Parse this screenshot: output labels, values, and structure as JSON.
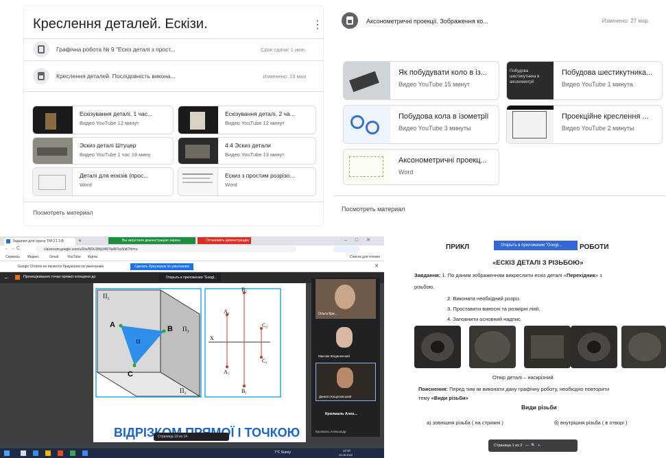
{
  "q1": {
    "title": "Креслення деталей. Ескізи.",
    "row1": {
      "title": "Графічна робота № 9 \"Ескіз деталі з прост...",
      "due": "Срок сдачи: 1 июн."
    },
    "row2": {
      "title": "Креслення деталей. Послідовність викона...",
      "changed": "Изменено: 23 мая"
    },
    "cards": [
      {
        "title": "Ескізування деталі, 1 час...",
        "meta": "Видео YouTube   12 минут"
      },
      {
        "title": "Ескізування деталі, 2 ча...",
        "meta": "Видео YouTube   12 минут"
      },
      {
        "title": "Эскиз деталі Штуцер",
        "meta": "Видео YouTube   1 час 19 мину"
      },
      {
        "title": "4 4 Эскиз детали",
        "meta": "Видео YouTube   13 минут"
      },
      {
        "title": "Деталі для ескізів (прос...",
        "meta": "Word"
      },
      {
        "title": "Ескиз з простим розрізо...",
        "meta": "Word"
      }
    ],
    "view": "Посмотреть материал"
  },
  "q2": {
    "title": "Аксонометричні проекції. Зображення ко...",
    "changed": "Изменено: 27 мар.",
    "cards": [
      {
        "title": "Як побудувати коло в із...",
        "meta": "Видео YouTube   15 минут"
      },
      {
        "title": "Побудова шестикутника...",
        "meta": "Видео YouTube   1 минута",
        "thumb": "Побудова шестикутника в аксонометрії"
      },
      {
        "title": "Побудова кола в ізометрії",
        "meta": "Видео YouTube   3 минуты"
      },
      {
        "title": "Проекційне креслення ...",
        "meta": "Видео YouTube   2 минуты"
      },
      {
        "title": "Аксонометричні проекц...",
        "meta": "Word"
      }
    ],
    "view": "Посмотреть материал"
  },
  "q3": {
    "banner_demo": "Вы запустили демонстрацию экрана",
    "banner_stop": "Остановить демонстрацию",
    "tab": "Задания для курса ТМ-21 1/8 ",
    "url": "classroom.google.com/u/0/w/NDU3MjU4NTkxNTkz/t/all?hl=ru",
    "bookmarks": [
      "Сервисы",
      "Яндекс",
      "Gmail",
      "YouTube",
      "Карты"
    ],
    "reading_list": "Список для чтения",
    "default_msg": "Google Chrome не является браузером по умолчанию.",
    "default_btn": "Сделать браузером по умолчанию",
    "slide_title": "Проекціювання точки прямої площини до",
    "open_with": "Открыть в приложении \"Googl...",
    "slide_caption": "ВІДРІЗКОМ ПРЯМОЇ І ТОЧКОЮ",
    "pg": "Страница",
    "pg_num": "10",
    "pg_sep": "из",
    "pg_total": "14",
    "participants": [
      "Ольга Кри...",
      "Максим Жадановский",
      "Данило Кощуловський",
      "Кролмаль Алек...",
      "Кролмаль Александр"
    ],
    "plane_labels": {
      "p2": "Π₂",
      "p1": "Π₁",
      "p3": "Π₃",
      "a": "A",
      "b": "B",
      "c": "C",
      "alpha": "α"
    },
    "proj_labels": {
      "b2": "B₂",
      "a2": "A₂",
      "c2": "C₂",
      "x": "X",
      "c1": "C₁",
      "a1": "A₁",
      "b1": "B₁"
    },
    "weather": "7°С Sunny",
    "time": "17:07",
    "date": "22.05.2022"
  },
  "q4": {
    "header": "ПРИКЛ",
    "open_with": "Открыть в приложении \"Googl...",
    "header_end": "РОБОТИ",
    "doc_title": "«ЕСКІЗ ДЕТАЛІ З РІЗЬБОЮ»",
    "task_label": "Завдання:",
    "task_1": "1. По даним зображенням викреслити ескіз деталі «",
    "task_1_bold": "Перехідник",
    "task_1_end": "» з",
    "task_1_cont": "різьбою.",
    "tasks": [
      "2. Виконати необхідний розріз.",
      "3. Проставити виносні та розмірні лінії.",
      "4. Заповнити основний надпис."
    ],
    "hole": "Отвір деталі – наскрізний.",
    "expl_label": "Пояснення:",
    "expl": "Перед тим як виконати дану графічну роботу, необхідно повторити",
    "expl_2a": "тему",
    "expl_2b": "«Види різьби»",
    "types_title": "Види різьби",
    "type_a": "а) зовнішня різьба ( на стрижні )",
    "type_b": "б) внутрішня різьба ( в отворі )",
    "pg": "Страница",
    "pg_num": "1",
    "pg_sep": "из",
    "pg_total": "2"
  }
}
